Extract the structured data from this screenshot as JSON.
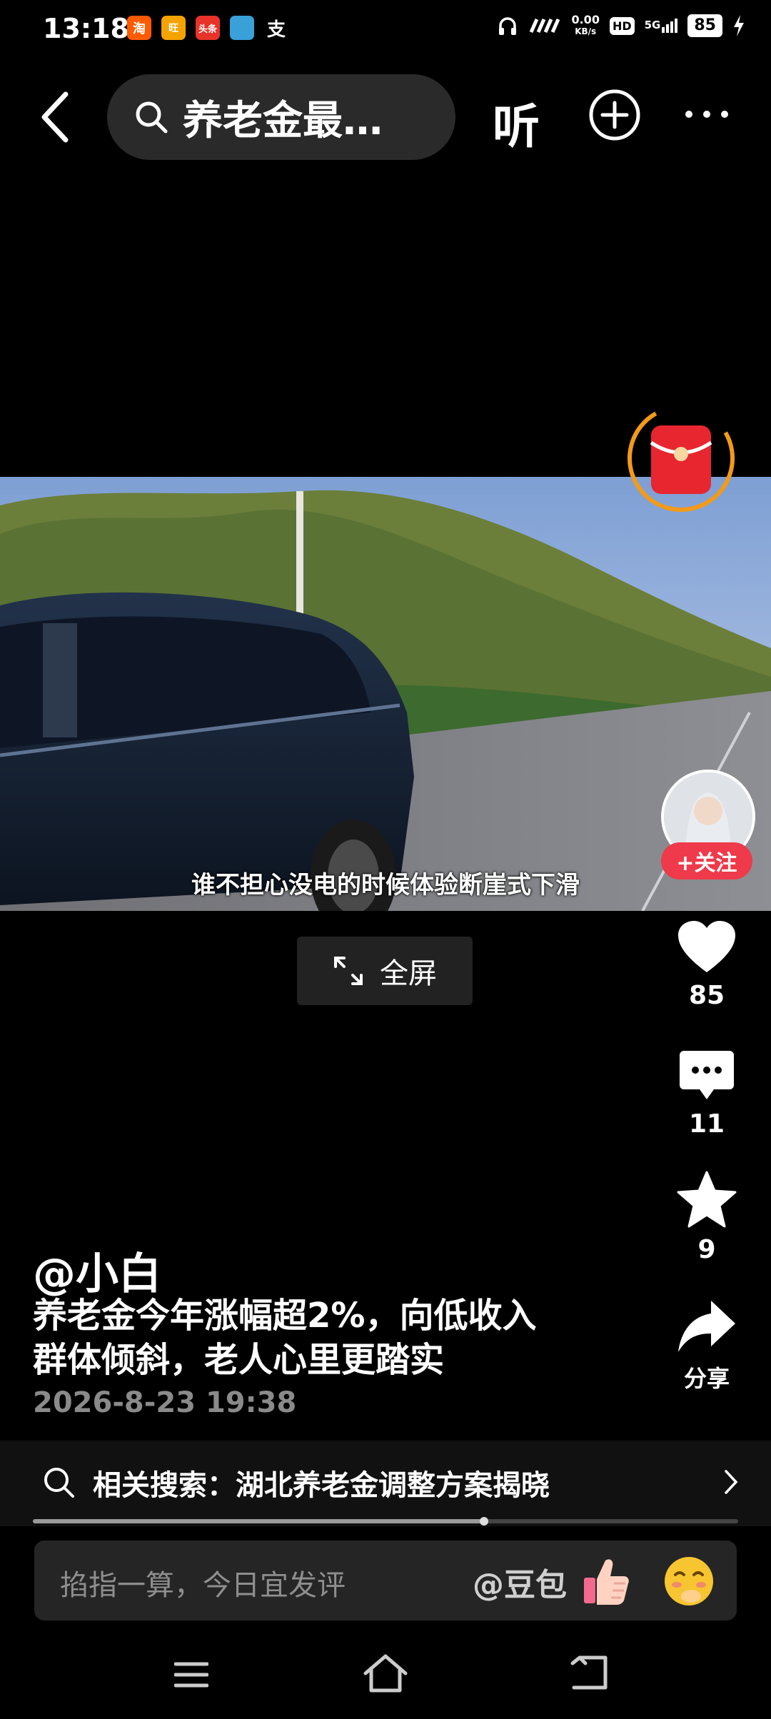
{
  "status_bar": {
    "time": "13:18",
    "app_icons": [
      {
        "label": "淘",
        "icon": "taobao-icon",
        "color": "#ff5a00"
      },
      {
        "label": "旺",
        "icon": "wangwang-icon",
        "color": "#f5a300"
      },
      {
        "label": "头条",
        "icon": "toutiao-icon",
        "color": "#e8332a"
      },
      {
        "label": "",
        "icon": "game-app-icon",
        "color": "#3aa0d8"
      },
      {
        "label": "支",
        "icon": "alipay-icon",
        "color": "#000000"
      }
    ],
    "net_speed_value": "0.00",
    "net_speed_unit": "KB/s",
    "hd_label": "HD",
    "signal_label": "5G",
    "battery": "85"
  },
  "top_bar": {
    "search_query": "养老金最…",
    "listen_label": "听"
  },
  "video": {
    "subtitle": "谁不担心没电的时候体验断崖式下滑"
  },
  "fullscreen_label": "全屏",
  "rail": {
    "follow_label": "+关注",
    "likes": "85",
    "comments": "11",
    "favorites": "9",
    "share_label": "分享"
  },
  "post": {
    "author": "@小白",
    "caption_line1": "养老金今年涨幅超2%，向低收入",
    "caption_line2": "群体倾斜，老人心里更踏实",
    "time": "2026-8-23 19:38"
  },
  "related_search": {
    "text": "相关搜索：湖北养老金调整方案揭晓"
  },
  "playback_progress": 0.64,
  "comment_bar": {
    "placeholder": "掐指一算，今日宜发评",
    "mention": "@豆包"
  }
}
